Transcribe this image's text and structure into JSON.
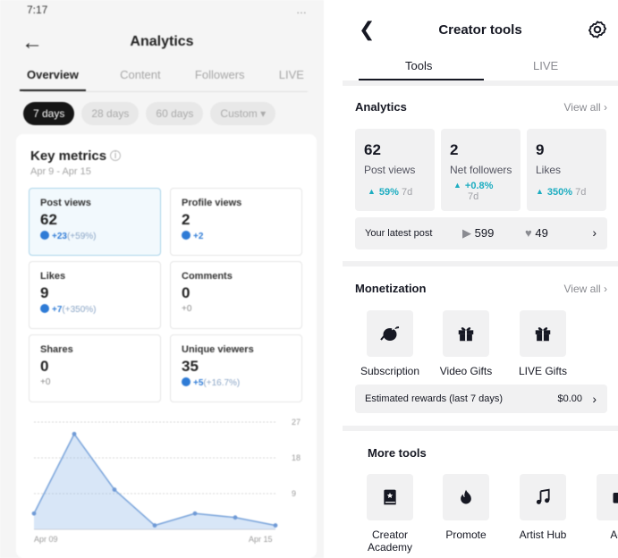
{
  "left": {
    "status_time": "7:17",
    "status_icons": "…",
    "title": "Analytics",
    "tabs": [
      "Overview",
      "Content",
      "Followers",
      "LIVE"
    ],
    "chips": [
      "7 days",
      "28 days",
      "60 days",
      "Custom"
    ],
    "key_metrics": {
      "title": "Key metrics",
      "date_range": "Apr 9 - Apr 15",
      "tiles": [
        {
          "label": "Post views",
          "value": "62",
          "delta": "+23",
          "pct": "(+59%)"
        },
        {
          "label": "Profile views",
          "value": "2",
          "delta": "+2",
          "pct": ""
        },
        {
          "label": "Likes",
          "value": "9",
          "delta": "+7",
          "pct": "(+350%)"
        },
        {
          "label": "Comments",
          "value": "0",
          "delta": "+0",
          "pct": ""
        },
        {
          "label": "Shares",
          "value": "0",
          "delta": "+0",
          "pct": ""
        },
        {
          "label": "Unique viewers",
          "value": "35",
          "delta": "+5",
          "pct": "(+16.7%)"
        }
      ]
    },
    "chart_data": {
      "type": "area",
      "title": "",
      "x": [
        "Apr 09",
        "Apr 10",
        "Apr 11",
        "Apr 12",
        "Apr 13",
        "Apr 14",
        "Apr 15"
      ],
      "series": [
        {
          "values": [
            4,
            24,
            10,
            1,
            4,
            3,
            1
          ]
        }
      ],
      "x_tick_labels": [
        "Apr 09",
        "Apr 15"
      ],
      "y_ticks": [
        "27",
        "18",
        "9"
      ],
      "ylim": [
        0,
        27
      ],
      "grid": true,
      "color": "#8fb7e8"
    }
  },
  "right": {
    "title": "Creator tools",
    "tabs": [
      "Tools",
      "LIVE"
    ],
    "analytics": {
      "title": "Analytics",
      "view_all": "View all",
      "stats": [
        {
          "value": "62",
          "label": "Post views",
          "delta": "59%",
          "period": "7d"
        },
        {
          "value": "2",
          "label": "Net followers",
          "delta": "+0.8%",
          "period": "7d"
        },
        {
          "value": "9",
          "label": "Likes",
          "delta": "350%",
          "period": "7d"
        }
      ],
      "latest_post": {
        "label": "Your latest post",
        "plays": "599",
        "likes": "49"
      }
    },
    "monetization": {
      "title": "Monetization",
      "view_all": "View all",
      "items": [
        "Subscription",
        "Video Gifts",
        "LIVE Gifts"
      ],
      "rewards_label": "Estimated rewards (last 7 days)",
      "rewards_value": "$0.00"
    },
    "more_tools": {
      "title": "More tools",
      "items": [
        "Creator Academy",
        "Promote",
        "Artist Hub",
        "Add"
      ]
    },
    "colors": {
      "accent": "#1dadc1",
      "text": "#161823",
      "muted": "#8a8b91",
      "surface": "#f1f1f2"
    }
  }
}
